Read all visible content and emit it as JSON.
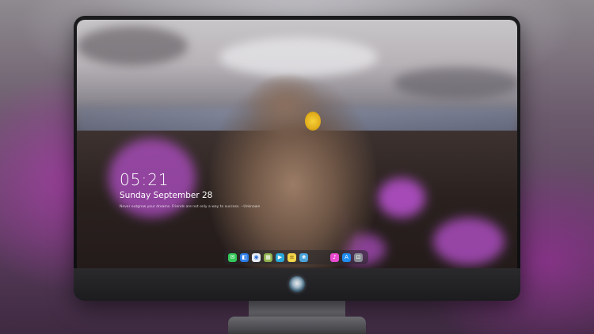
{
  "lock_screen": {
    "time": "05:21",
    "date": "Sunday September  28",
    "quote": "Never outgrow your dreams. Friends are not only a way to success.  --Unknown"
  },
  "dock": {
    "items": [
      {
        "name": "messages-icon",
        "glyph": "✉",
        "color": "#34c759"
      },
      {
        "name": "finder-icon",
        "glyph": "◧",
        "color": "#2b7de9"
      },
      {
        "name": "safari-icon",
        "glyph": "◉",
        "color": "#e9eef5"
      },
      {
        "name": "preview-icon",
        "glyph": "▦",
        "color": "#8fb34d"
      },
      {
        "name": "video-icon",
        "glyph": "▶",
        "color": "#2aa7d8"
      },
      {
        "name": "notes-icon",
        "glyph": "≡",
        "color": "#f3d64a"
      },
      {
        "name": "photos-icon",
        "glyph": "❀",
        "color": "#4ba3d9"
      },
      {
        "name": "music-icon",
        "glyph": "♪",
        "color": "#e94bd0"
      },
      {
        "name": "appstore-icon",
        "glyph": "A",
        "color": "#1f8ef1"
      },
      {
        "name": "screenshot-icon",
        "glyph": "⊡",
        "color": "#8a8f96"
      }
    ]
  }
}
